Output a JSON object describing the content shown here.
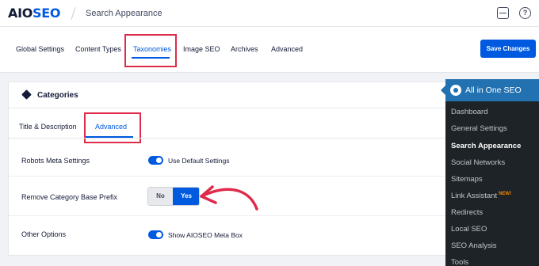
{
  "header": {
    "logo_part1": "AIO",
    "logo_part2": "SEO",
    "page_title": "Search Appearance",
    "help_glyph": "?"
  },
  "tabs": [
    {
      "label": "Global Settings"
    },
    {
      "label": "Content Types"
    },
    {
      "label": "Taxonomies"
    },
    {
      "label": "Image SEO"
    },
    {
      "label": "Archives"
    },
    {
      "label": "Advanced"
    }
  ],
  "active_tab": "Taxonomies",
  "save_button": "Save Changes",
  "card": {
    "title": "Categories",
    "subtabs": [
      {
        "label": "Title & Description"
      },
      {
        "label": "Advanced"
      }
    ],
    "active_subtab": "Advanced",
    "rows": {
      "robots": {
        "label": "Robots Meta Settings",
        "toggle_label": "Use Default Settings",
        "toggle_on": true
      },
      "remove_base": {
        "label": "Remove Category Base Prefix",
        "no_label": "No",
        "yes_label": "Yes",
        "selected": "Yes"
      },
      "other": {
        "label": "Other Options",
        "toggle_label": "Show AIOSEO Meta Box",
        "toggle_on": true
      }
    }
  },
  "wp_menu": {
    "title": "All in One SEO",
    "items": [
      {
        "label": "Dashboard"
      },
      {
        "label": "General Settings"
      },
      {
        "label": "Search Appearance"
      },
      {
        "label": "Social Networks"
      },
      {
        "label": "Sitemaps"
      },
      {
        "label": "Link Assistant"
      },
      {
        "label": "Redirects"
      },
      {
        "label": "Local SEO"
      },
      {
        "label": "SEO Analysis"
      },
      {
        "label": "Tools"
      }
    ],
    "current": "Search Appearance",
    "new_badge": "NEW!"
  },
  "colors": {
    "accent": "#005ae0",
    "highlight": "#df2a4a",
    "wp_menu_bg": "#1d2327",
    "wp_menu_active": "#2271b1"
  }
}
